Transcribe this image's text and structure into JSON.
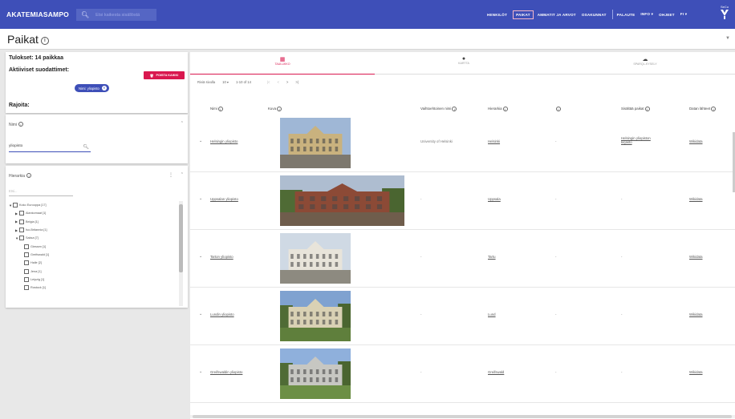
{
  "app": {
    "brand": "AKATEMIASAMPO",
    "search_placeholder": "Etsi kaikesta sisällöstä",
    "nav": [
      "HENKILÖT",
      "PAIKAT",
      "AMMATIT JA ARVOT",
      "OSAKUNNAT",
      "PALAUTE",
      "INFO ▾",
      "OHJEET",
      "FI ▾"
    ],
    "nav_active": "PAIKAT",
    "logo_text": "SeCo"
  },
  "page": {
    "title": "Paikat",
    "info_glyph": "i"
  },
  "filters": {
    "results": "Tulokset: 14 paikkaa",
    "active_label": "Aktiiviset suodattimet:",
    "remove_button": "POISTA KAIKKI",
    "chip": "Nimi: yliopisto",
    "rajoita": "Rajoita:"
  },
  "facet_name": {
    "title": "Nimi",
    "value": "yliopisto"
  },
  "facet_hierarchy": {
    "title": "Hierarkia",
    "filter_placeholder": "Etsi...",
    "nodes": [
      {
        "label": "Koko Eurooppa [17]",
        "level": 0,
        "expanded": true
      },
      {
        "label": "Alankomaat [1]",
        "level": 1,
        "expanded": false
      },
      {
        "label": "Belgia [1]",
        "level": 1,
        "expanded": false
      },
      {
        "label": "Iso-Britannia [1]",
        "level": 1,
        "expanded": false
      },
      {
        "label": "Saksa [7]",
        "level": 1,
        "expanded": true
      },
      {
        "label": "Giessen [1]",
        "level": 2,
        "expanded": null
      },
      {
        "label": "Greifswald [1]",
        "level": 2,
        "expanded": null
      },
      {
        "label": "Halle [2]",
        "level": 2,
        "expanded": null
      },
      {
        "label": "Jena [1]",
        "level": 2,
        "expanded": null
      },
      {
        "label": "Leipzig [1]",
        "level": 2,
        "expanded": null
      },
      {
        "label": "Rostock [1]",
        "level": 2,
        "expanded": null
      }
    ]
  },
  "tabs": [
    {
      "label": "TAULUKKO",
      "icon": "table-icon",
      "glyph": "▦"
    },
    {
      "label": "KARTTA",
      "icon": "map-pin-icon",
      "glyph": "⬤"
    },
    {
      "label": "SPARQL-KYSELY",
      "icon": "cloud-download-icon",
      "glyph": "☁"
    }
  ],
  "pagination": {
    "rows_per_page_label": "Riviä sivulla",
    "rows_per_page": "10 ▾",
    "range": "1-10 of 14",
    "buttons": [
      "|<",
      "<",
      ">",
      ">|"
    ]
  },
  "table": {
    "headers": [
      "Nimi",
      "Kuva",
      "Vaihtoehtoinen nimi",
      "Hierarkia",
      "",
      "Sisältää paikat",
      "Datan lähteet"
    ],
    "rows": [
      {
        "name": "Helsingin yliopisto",
        "alt": "University of Helsinki",
        "hierarchy": "Helsinki",
        "dash": "-",
        "contains": "Helsingin yliopiston kirjasto",
        "source": "Wikidata"
      },
      {
        "name": "Uppsalan yliopisto",
        "alt": "-",
        "hierarchy": "Uppsala",
        "dash": "-",
        "contains": "-",
        "source": "Wikidata"
      },
      {
        "name": "Tarton yliopisto",
        "alt": "-",
        "hierarchy": "Tartu",
        "dash": "-",
        "contains": "-",
        "source": "Wikidata"
      },
      {
        "name": "Lundin yliopisto",
        "alt": "-",
        "hierarchy": "Lund",
        "dash": "-",
        "contains": "-",
        "source": "Wikidata"
      },
      {
        "name": "Greifswaldin yliopisto",
        "alt": "-",
        "hierarchy": "Greifswald",
        "dash": "-",
        "contains": "-",
        "source": "Wikidata"
      }
    ]
  },
  "colors": {
    "primary": "#3e4fb8",
    "accent": "#d9184f"
  }
}
